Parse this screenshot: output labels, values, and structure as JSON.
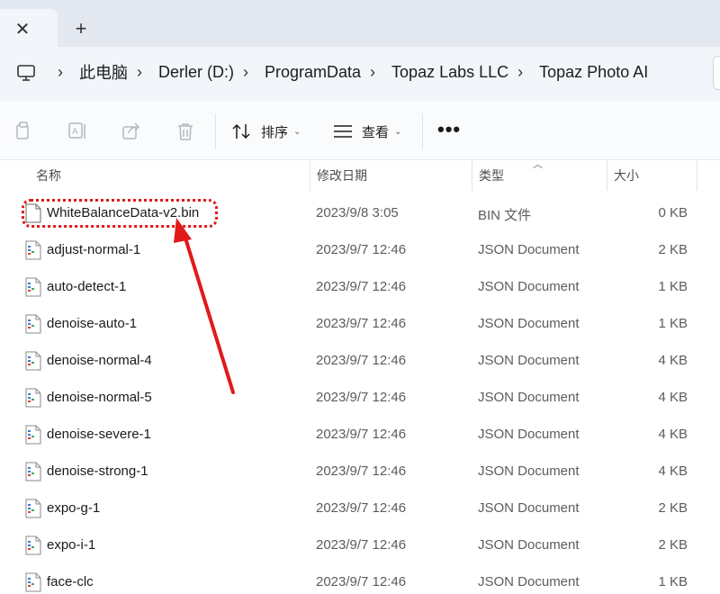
{
  "tabbar": {
    "close_glyph": "✕",
    "new_tab_glyph": "+"
  },
  "breadcrumb": {
    "items": [
      "此电脑",
      "Derler (D:)",
      "ProgramData",
      "Topaz Labs LLC",
      "Topaz Photo AI"
    ],
    "separator": "›"
  },
  "command_bar": {
    "sort_label": "排序",
    "view_label": "查看",
    "more_glyph": "•••",
    "icons": [
      "copy-icon",
      "rename-icon",
      "share-icon",
      "delete-icon",
      "sort-icon",
      "view-icon",
      "more-icon"
    ]
  },
  "columns": {
    "name": "名称",
    "modified": "修改日期",
    "type": "类型",
    "size": "大小"
  },
  "files": [
    {
      "name": "WhiteBalanceData-v2.bin",
      "modified": "2023/9/8 3:05",
      "type": "BIN 文件",
      "size": "0 KB",
      "icon": "file-icon"
    },
    {
      "name": "adjust-normal-1",
      "modified": "2023/9/7 12:46",
      "type": "JSON Document",
      "size": "2 KB",
      "icon": "json-file-icon"
    },
    {
      "name": "auto-detect-1",
      "modified": "2023/9/7 12:46",
      "type": "JSON Document",
      "size": "1 KB",
      "icon": "json-file-icon"
    },
    {
      "name": "denoise-auto-1",
      "modified": "2023/9/7 12:46",
      "type": "JSON Document",
      "size": "1 KB",
      "icon": "json-file-icon"
    },
    {
      "name": "denoise-normal-4",
      "modified": "2023/9/7 12:46",
      "type": "JSON Document",
      "size": "4 KB",
      "icon": "json-file-icon"
    },
    {
      "name": "denoise-normal-5",
      "modified": "2023/9/7 12:46",
      "type": "JSON Document",
      "size": "4 KB",
      "icon": "json-file-icon"
    },
    {
      "name": "denoise-severe-1",
      "modified": "2023/9/7 12:46",
      "type": "JSON Document",
      "size": "4 KB",
      "icon": "json-file-icon"
    },
    {
      "name": "denoise-strong-1",
      "modified": "2023/9/7 12:46",
      "type": "JSON Document",
      "size": "4 KB",
      "icon": "json-file-icon"
    },
    {
      "name": "expo-g-1",
      "modified": "2023/9/7 12:46",
      "type": "JSON Document",
      "size": "2 KB",
      "icon": "json-file-icon"
    },
    {
      "name": "expo-i-1",
      "modified": "2023/9/7 12:46",
      "type": "JSON Document",
      "size": "2 KB",
      "icon": "json-file-icon"
    },
    {
      "name": "face-clc",
      "modified": "2023/9/7 12:46",
      "type": "JSON Document",
      "size": "1 KB",
      "icon": "json-file-icon"
    }
  ],
  "annotation": {
    "color": "#e11919",
    "highlighted_file": "WhiteBalanceData-v2.bin"
  }
}
